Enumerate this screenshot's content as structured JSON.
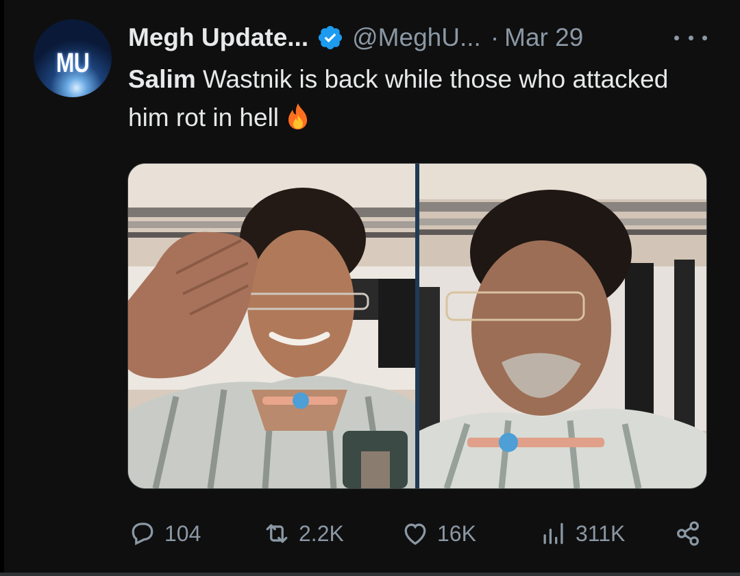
{
  "tweet": {
    "avatar_text": "MU",
    "display_name": "Megh Update...",
    "handle": "@MeghU...",
    "separator": "·",
    "date": "Mar 29",
    "text_bold": "Salim",
    "text_rest": " Wastnik is back while those who attacked him rot in hell",
    "emoji_icon": "fire-icon"
  },
  "media": {
    "count": 2,
    "items": [
      {
        "type": "photo",
        "subject": "salute"
      },
      {
        "type": "photo",
        "subject": "portrait"
      }
    ]
  },
  "actions": {
    "replies": "104",
    "reposts": "2.2K",
    "likes": "16K",
    "views": "311K"
  },
  "colors": {
    "verified": "#1d9bf0",
    "secondary_text": "#8b98a5",
    "primary_text": "#e7e9ea",
    "background": "#0f0f0f"
  }
}
